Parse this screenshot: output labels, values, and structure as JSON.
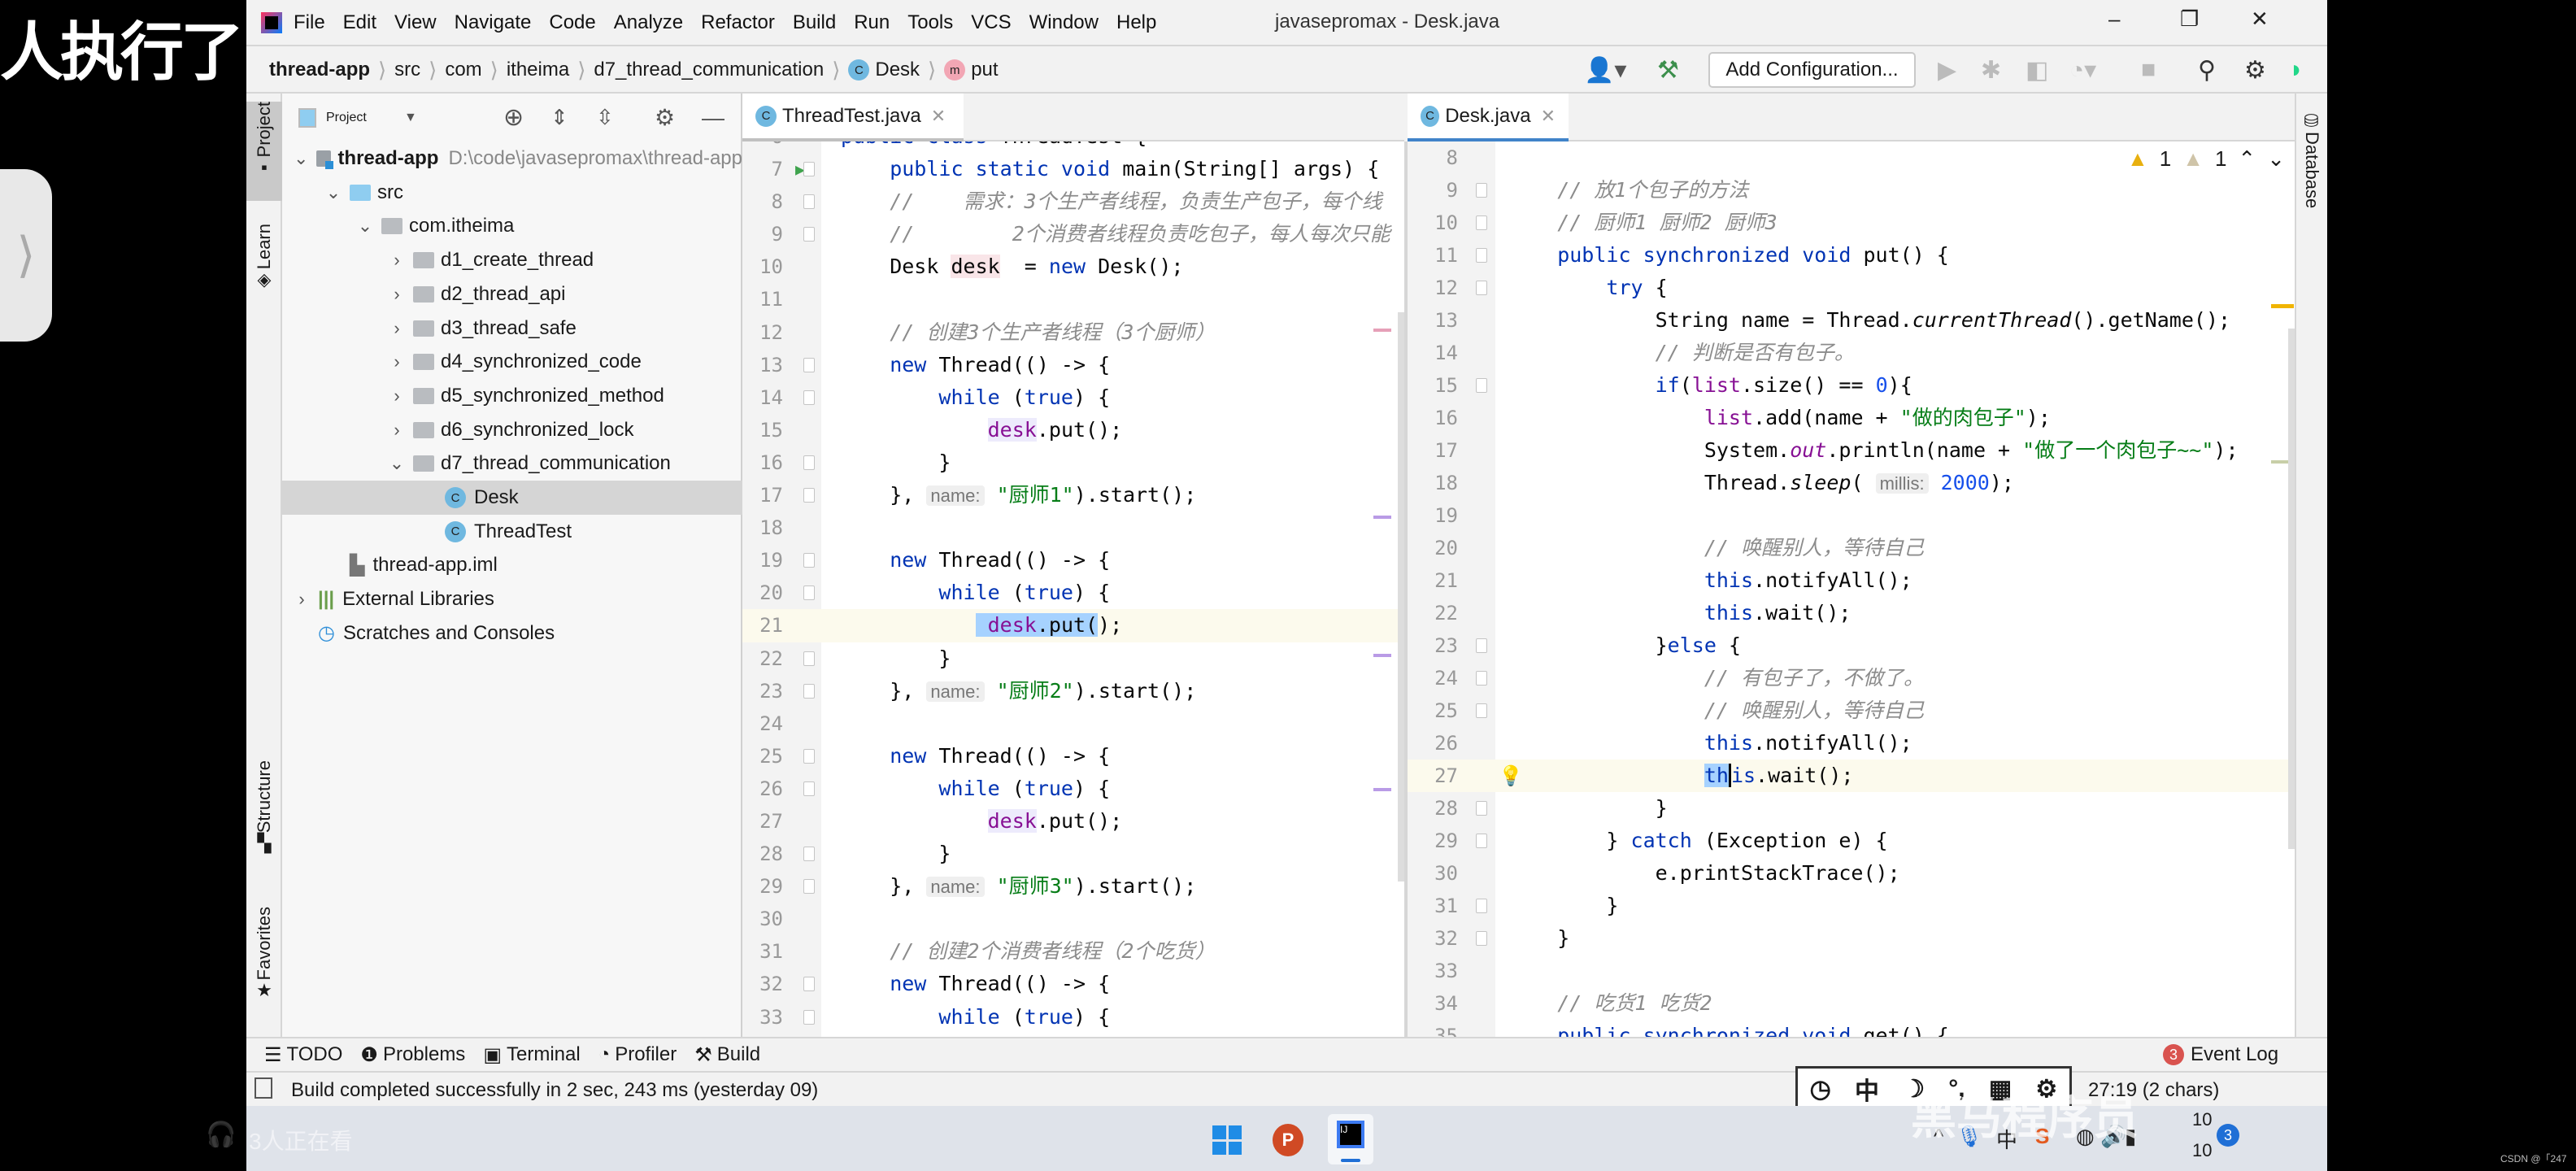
{
  "overlay": {
    "top_left_text": "人执行了",
    "side_tab_glyph": "⟩",
    "watermark": "黑马程序员",
    "viewer_count": "3人正在看",
    "csdn": "CSDN @「247"
  },
  "menubar": {
    "items": [
      "File",
      "Edit",
      "View",
      "Navigate",
      "Code",
      "Analyze",
      "Refactor",
      "Build",
      "Run",
      "Tools",
      "VCS",
      "Window",
      "Help"
    ],
    "title": "javasepromax - Desk.java"
  },
  "breadcrumb": [
    "thread-app",
    "src",
    "com",
    "itheima",
    "d7_thread_communication",
    "Desk",
    "put"
  ],
  "toolbar": {
    "add_configuration": "Add Configuration..."
  },
  "toolstrip": {
    "project": "Project",
    "learn": "Learn",
    "structure": "Structure",
    "favorites": "Favorites",
    "database": "Database"
  },
  "project": {
    "title": "Project",
    "tree": [
      {
        "label": "thread-app",
        "path": "D:\\code\\javasepromax\\thread-app",
        "level": 0,
        "chev": "v",
        "icon": "module"
      },
      {
        "label": "src",
        "level": 1,
        "chev": "v",
        "icon": "src"
      },
      {
        "label": "com.itheima",
        "level": 2,
        "chev": "v",
        "icon": "package"
      },
      {
        "label": "d1_create_thread",
        "level": 3,
        "chev": ">",
        "icon": "package"
      },
      {
        "label": "d2_thread_api",
        "level": 3,
        "chev": ">",
        "icon": "package"
      },
      {
        "label": "d3_thread_safe",
        "level": 3,
        "chev": ">",
        "icon": "package"
      },
      {
        "label": "d4_synchronized_code",
        "level": 3,
        "chev": ">",
        "icon": "package"
      },
      {
        "label": "d5_synchronized_method",
        "level": 3,
        "chev": ">",
        "icon": "package"
      },
      {
        "label": "d6_synchronized_lock",
        "level": 3,
        "chev": ">",
        "icon": "package"
      },
      {
        "label": "d7_thread_communication",
        "level": 3,
        "chev": "v",
        "icon": "package"
      },
      {
        "label": "Desk",
        "level": 4,
        "chev": "",
        "icon": "class",
        "selected": true
      },
      {
        "label": "ThreadTest",
        "level": 4,
        "chev": "",
        "icon": "class-run"
      },
      {
        "label": "thread-app.iml",
        "level": 1,
        "chev": "",
        "icon": "file"
      },
      {
        "label": "External Libraries",
        "level": 0,
        "chev": ">",
        "icon": "library"
      },
      {
        "label": "Scratches and Consoles",
        "level": 0,
        "chev": "",
        "icon": "scratch"
      }
    ]
  },
  "tabs": {
    "left": "ThreadTest.java",
    "right": "Desk.java",
    "active": "Desk.java"
  },
  "inspections": {
    "warnings": "1",
    "weak_warnings": "1"
  },
  "threadtest": {
    "lines": [
      {
        "n": 6,
        "t": [
          [
            "kw",
            "public class "
          ],
          [
            "p",
            "ThreadTest {"
          ]
        ]
      },
      {
        "n": 7,
        "run": true,
        "fold": true,
        "t": [
          [
            "kw",
            "    public static void "
          ],
          [
            "p",
            "main(String[] args) {"
          ]
        ]
      },
      {
        "n": 8,
        "fold": true,
        "t": [
          [
            "cmt",
            "    //    需求：3个生产者线程，负责生产包子，每个线"
          ]
        ]
      },
      {
        "n": 9,
        "fold": true,
        "t": [
          [
            "cmt",
            "    //        2个消费者线程负责吃包子，每人每次只能"
          ]
        ]
      },
      {
        "n": 10,
        "t": [
          [
            "p",
            "    Desk "
          ],
          [
            "p varhl",
            "desk"
          ],
          [
            "p",
            "  = "
          ],
          [
            "kw",
            "new "
          ],
          [
            "p",
            "Desk();"
          ]
        ]
      },
      {
        "n": 11,
        "t": []
      },
      {
        "n": 12,
        "t": [
          [
            "cmt",
            "    // 创建3个生产者线程（3个厨师）"
          ]
        ]
      },
      {
        "n": 13,
        "fold": true,
        "t": [
          [
            "kw",
            "    new "
          ],
          [
            "p",
            "Thread(() -> {"
          ]
        ]
      },
      {
        "n": 14,
        "fold": true,
        "t": [
          [
            "kw",
            "        while "
          ],
          [
            "p",
            "("
          ],
          [
            "kw",
            "true"
          ],
          [
            "p",
            ") {"
          ]
        ]
      },
      {
        "n": 15,
        "t": [
          [
            "p",
            "            "
          ],
          [
            "fld usage",
            "desk"
          ],
          [
            "p",
            ".put();"
          ]
        ]
      },
      {
        "n": 16,
        "fold": true,
        "t": [
          [
            "p",
            "        }"
          ]
        ]
      },
      {
        "n": 17,
        "fold": true,
        "t": [
          [
            "p",
            "    }, "
          ],
          [
            "hint",
            "name:"
          ],
          [
            "str",
            " \"厨师1\""
          ],
          [
            "p",
            ").start();"
          ]
        ]
      },
      {
        "n": 18,
        "t": []
      },
      {
        "n": 19,
        "fold": true,
        "t": [
          [
            "kw",
            "    new "
          ],
          [
            "p",
            "Thread(() -> {"
          ]
        ]
      },
      {
        "n": 20,
        "fold": true,
        "t": [
          [
            "kw",
            "        while "
          ],
          [
            "p",
            "("
          ],
          [
            "kw",
            "true"
          ],
          [
            "p",
            ") {"
          ]
        ]
      },
      {
        "n": 21,
        "cur": true,
        "t": [
          [
            "p",
            "           "
          ],
          [
            "fld sel",
            " desk"
          ],
          [
            "p sel",
            ".put("
          ],
          [
            "p",
            ");"
          ]
        ]
      },
      {
        "n": 22,
        "fold": true,
        "t": [
          [
            "p",
            "        }"
          ]
        ]
      },
      {
        "n": 23,
        "fold": true,
        "t": [
          [
            "p",
            "    }, "
          ],
          [
            "hint",
            "name:"
          ],
          [
            "str",
            " \"厨师2\""
          ],
          [
            "p",
            ").start();"
          ]
        ]
      },
      {
        "n": 24,
        "t": []
      },
      {
        "n": 25,
        "fold": true,
        "t": [
          [
            "kw",
            "    new "
          ],
          [
            "p",
            "Thread(() -> {"
          ]
        ]
      },
      {
        "n": 26,
        "fold": true,
        "t": [
          [
            "kw",
            "        while "
          ],
          [
            "p",
            "("
          ],
          [
            "kw",
            "true"
          ],
          [
            "p",
            ") {"
          ]
        ]
      },
      {
        "n": 27,
        "t": [
          [
            "p",
            "            "
          ],
          [
            "fld usage",
            "desk"
          ],
          [
            "p",
            ".put();"
          ]
        ]
      },
      {
        "n": 28,
        "fold": true,
        "t": [
          [
            "p",
            "        }"
          ]
        ]
      },
      {
        "n": 29,
        "fold": true,
        "t": [
          [
            "p",
            "    }, "
          ],
          [
            "hint",
            "name:"
          ],
          [
            "str",
            " \"厨师3\""
          ],
          [
            "p",
            ").start();"
          ]
        ]
      },
      {
        "n": 30,
        "t": []
      },
      {
        "n": 31,
        "t": [
          [
            "cmt",
            "    // 创建2个消费者线程（2个吃货）"
          ]
        ]
      },
      {
        "n": 32,
        "fold": true,
        "t": [
          [
            "kw",
            "    new "
          ],
          [
            "p",
            "Thread(() -> {"
          ]
        ]
      },
      {
        "n": 33,
        "fold": true,
        "t": [
          [
            "kw",
            "        while "
          ],
          [
            "p",
            "("
          ],
          [
            "kw",
            "true"
          ],
          [
            "p",
            ") {"
          ]
        ]
      }
    ]
  },
  "desk": {
    "lines": [
      {
        "n": 8,
        "t": []
      },
      {
        "n": 9,
        "fold": true,
        "t": [
          [
            "cmt",
            "    // 放1个包子的方法"
          ]
        ]
      },
      {
        "n": 10,
        "fold": true,
        "t": [
          [
            "cmt",
            "    // 厨师1 厨师2 厨师3"
          ]
        ]
      },
      {
        "n": 11,
        "fold": true,
        "t": [
          [
            "kw",
            "    public synchronized void "
          ],
          [
            "p",
            "put() {"
          ]
        ]
      },
      {
        "n": 12,
        "fold": true,
        "t": [
          [
            "kw",
            "        try "
          ],
          [
            "p",
            "{"
          ]
        ]
      },
      {
        "n": 13,
        "t": [
          [
            "p",
            "            String name = Thread."
          ],
          [
            "p it",
            "currentThread"
          ],
          [
            "p",
            "().getName();"
          ]
        ]
      },
      {
        "n": 14,
        "t": [
          [
            "cmt",
            "            // 判断是否有包子。"
          ]
        ]
      },
      {
        "n": 15,
        "fold": true,
        "t": [
          [
            "kw",
            "            if"
          ],
          [
            "p",
            "("
          ],
          [
            "fld",
            "list"
          ],
          [
            "p",
            ".size() == "
          ],
          [
            "num",
            "0"
          ],
          [
            "p",
            "){"
          ]
        ]
      },
      {
        "n": 16,
        "t": [
          [
            "fld",
            "                list"
          ],
          [
            "p",
            ".add(name + "
          ],
          [
            "str",
            "\"做的肉包子\""
          ],
          [
            "p",
            ");"
          ]
        ]
      },
      {
        "n": 17,
        "t": [
          [
            "p",
            "                System."
          ],
          [
            "fld it",
            "out"
          ],
          [
            "p",
            ".println(name + "
          ],
          [
            "str",
            "\"做了一个肉包子~~\""
          ],
          [
            "p",
            ");"
          ]
        ]
      },
      {
        "n": 18,
        "t": [
          [
            "p",
            "                Thread."
          ],
          [
            "p it",
            "sleep"
          ],
          [
            "p",
            "( "
          ],
          [
            "hint",
            "millis:"
          ],
          [
            "num",
            " 2000"
          ],
          [
            "p",
            ");"
          ]
        ]
      },
      {
        "n": 19,
        "t": []
      },
      {
        "n": 20,
        "t": [
          [
            "cmt",
            "                // 唤醒别人，等待自己"
          ]
        ]
      },
      {
        "n": 21,
        "t": [
          [
            "kw",
            "                this"
          ],
          [
            "p",
            ".notifyAll();"
          ]
        ]
      },
      {
        "n": 22,
        "t": [
          [
            "kw",
            "                this"
          ],
          [
            "p",
            ".wait();"
          ]
        ]
      },
      {
        "n": 23,
        "fold": true,
        "t": [
          [
            "p",
            "            }"
          ],
          [
            "kw",
            "else "
          ],
          [
            "p",
            "{"
          ]
        ]
      },
      {
        "n": 24,
        "fold": true,
        "t": [
          [
            "cmt",
            "                // 有包子了，不做了。"
          ]
        ]
      },
      {
        "n": 25,
        "fold": true,
        "t": [
          [
            "cmt",
            "                // 唤醒别人，等待自己"
          ]
        ]
      },
      {
        "n": 26,
        "t": [
          [
            "kw",
            "                this"
          ],
          [
            "p",
            ".notifyAll();"
          ]
        ]
      },
      {
        "n": 27,
        "cur": true,
        "bulb": true,
        "t": [
          [
            "p",
            "                "
          ],
          [
            "kw sel",
            "th"
          ],
          [
            "caret",
            ""
          ],
          [
            "kw",
            "is"
          ],
          [
            "p",
            ".wait();"
          ]
        ]
      },
      {
        "n": 28,
        "fold": true,
        "t": [
          [
            "p",
            "            }"
          ]
        ]
      },
      {
        "n": 29,
        "fold": true,
        "t": [
          [
            "p",
            "        } "
          ],
          [
            "kw",
            "catch "
          ],
          [
            "p",
            "(Exception e) {"
          ]
        ]
      },
      {
        "n": 30,
        "t": [
          [
            "p",
            "            e.printStackTrace();"
          ]
        ]
      },
      {
        "n": 31,
        "fold": true,
        "t": [
          [
            "p",
            "        }"
          ]
        ]
      },
      {
        "n": 32,
        "fold": true,
        "t": [
          [
            "p",
            "    }"
          ]
        ]
      },
      {
        "n": 33,
        "t": []
      },
      {
        "n": 34,
        "t": [
          [
            "cmt",
            "    // 吃货1 吃货2"
          ]
        ]
      },
      {
        "n": 35,
        "t": [
          [
            "kw",
            "    public synchronized void "
          ],
          [
            "p",
            "get() {"
          ]
        ]
      }
    ]
  },
  "bottom_tools": [
    "TODO",
    "Problems",
    "Terminal",
    "Profiler",
    "Build"
  ],
  "event_log": {
    "label": "Event Log",
    "count": "3"
  },
  "status": {
    "message": "Build completed successfully in 2 sec, 243 ms (yesterday 09)",
    "position": "27:19 (2 chars)"
  },
  "ime": [
    "◷",
    "中",
    "☽",
    "°,",
    "▦",
    "⚙"
  ],
  "tray": {
    "chevron": "^",
    "ime": "中",
    "time_top": "10",
    "time_bottom": "10",
    "notifications": "3"
  },
  "colors": {
    "keyword": "#0033b3",
    "string": "#067d17",
    "comment": "#8c8c8c",
    "field": "#871094",
    "number": "#1750eb",
    "selection": "#a6d2ff"
  }
}
